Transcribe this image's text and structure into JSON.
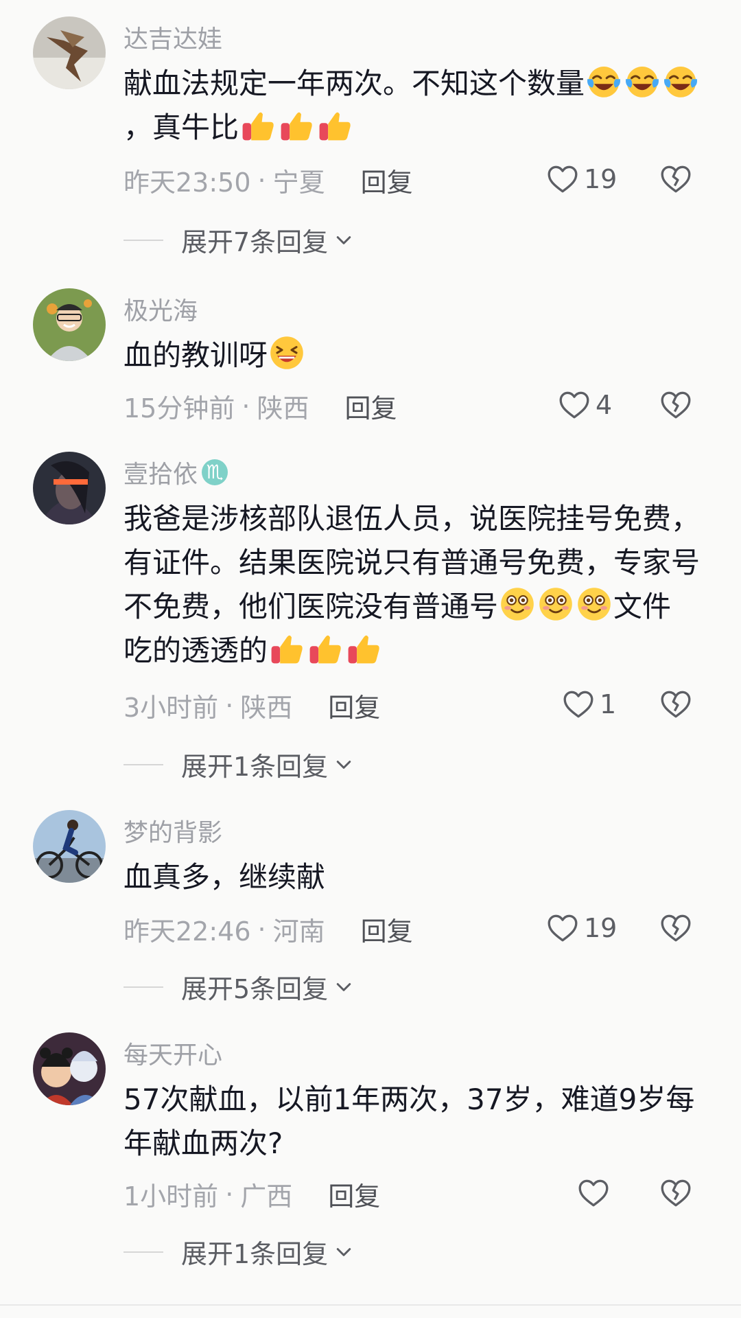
{
  "comments": [
    {
      "user": "达吉达娃",
      "text_a": "献血法规定一年两次。不知这个数量",
      "text_b": "，真牛比",
      "time": "昨天23:50",
      "location": "宁夏",
      "reply_label": "回复",
      "likes": "19",
      "expand": "展开7条回复"
    },
    {
      "user": "极光海",
      "text_a": "血的教训呀",
      "time": "15分钟前",
      "location": "陕西",
      "reply_label": "回复",
      "likes": "4"
    },
    {
      "user": "壹拾依",
      "zodiac": "♏",
      "text_a": "我爸是涉核部队退伍人员，说医院挂号免费，有证件。结果医院说只有普通号免费，专家号不免费，他们医院没有普通号",
      "text_b": "文件吃的透透的",
      "time": "3小时前",
      "location": "陕西",
      "reply_label": "回复",
      "likes": "1",
      "expand": "展开1条回复"
    },
    {
      "user": "梦的背影",
      "text_a": "血真多，继续献",
      "time": "昨天22:46",
      "location": "河南",
      "reply_label": "回复",
      "likes": "19",
      "expand": "展开5条回复"
    },
    {
      "user": "每天开心",
      "text_a": "57次献血，以前1年两次，37岁，难道9岁每年献血两次?",
      "time": "1小时前",
      "location": "广西",
      "reply_label": "回复",
      "likes": "",
      "expand": "展开1条回复"
    }
  ],
  "meta_separator": "·",
  "icons": {
    "like": "heart-outline-icon",
    "dislike": "broken-heart-icon",
    "expand": "chevron-down-icon",
    "emoji_laugh_cry": "laugh-cry-emoji",
    "emoji_thumbs_up": "thumbs-up-emoji",
    "emoji_grin": "grin-emoji",
    "emoji_smile_blush": "blush-smile-emoji"
  }
}
